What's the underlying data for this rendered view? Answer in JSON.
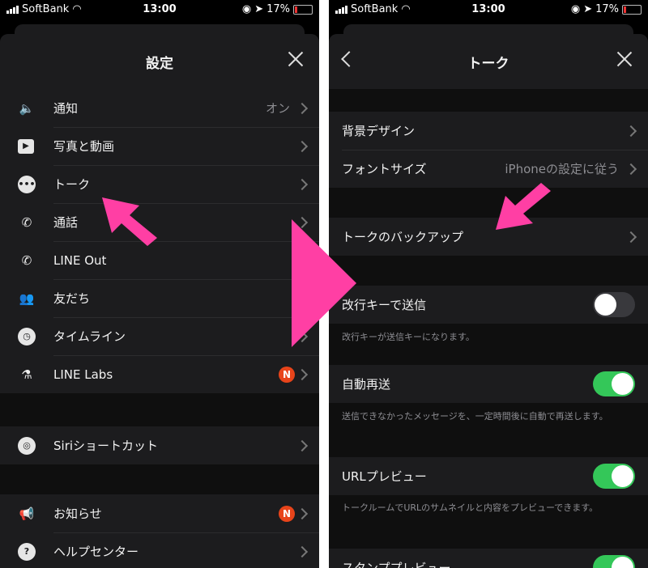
{
  "status": {
    "carrier": "SoftBank",
    "time": "13:00",
    "battery": "17%"
  },
  "left": {
    "title": "設定",
    "group1": [
      {
        "label": "通知",
        "value": "オン",
        "icon": "speaker-icon"
      },
      {
        "label": "写真と動画",
        "icon": "play-icon"
      },
      {
        "label": "トーク",
        "icon": "chat-bubble-icon"
      },
      {
        "label": "通話",
        "icon": "phone-icon"
      },
      {
        "label": "LINE Out",
        "icon": "phone-out-icon"
      },
      {
        "label": "友だち",
        "icon": "friends-icon"
      },
      {
        "label": "タイムライン",
        "icon": "clock-icon"
      },
      {
        "label": "LINE Labs",
        "badge": "N",
        "icon": "flask-icon"
      }
    ],
    "group2": [
      {
        "label": "Siriショートカット",
        "icon": "siri-icon"
      }
    ],
    "group3": [
      {
        "label": "お知らせ",
        "badge": "N",
        "icon": "megaphone-icon"
      },
      {
        "label": "ヘルプセンター",
        "icon": "help-icon"
      }
    ]
  },
  "right": {
    "title": "トーク",
    "group1": [
      {
        "label": "背景デザイン"
      },
      {
        "label": "フォントサイズ",
        "value": "iPhoneの設定に従う"
      }
    ],
    "backup": {
      "label": "トークのバックアップ"
    },
    "enter_send": {
      "label": "改行キーで送信",
      "on": false,
      "note": "改行キーが送信キーになります。"
    },
    "auto_resend": {
      "label": "自動再送",
      "on": true,
      "note": "送信できなかったメッセージを、一定時間後に自動で再送します。"
    },
    "url_preview": {
      "label": "URLプレビュー",
      "on": true,
      "note": "トークルームでURLのサムネイルと内容をプレビューできます。"
    },
    "stamp_preview": {
      "label": "スタンププレビュー",
      "on": true
    }
  },
  "colors": {
    "accent_pink": "#ff3fa4",
    "toggle_on": "#34c759",
    "badge": "#e8441a"
  }
}
